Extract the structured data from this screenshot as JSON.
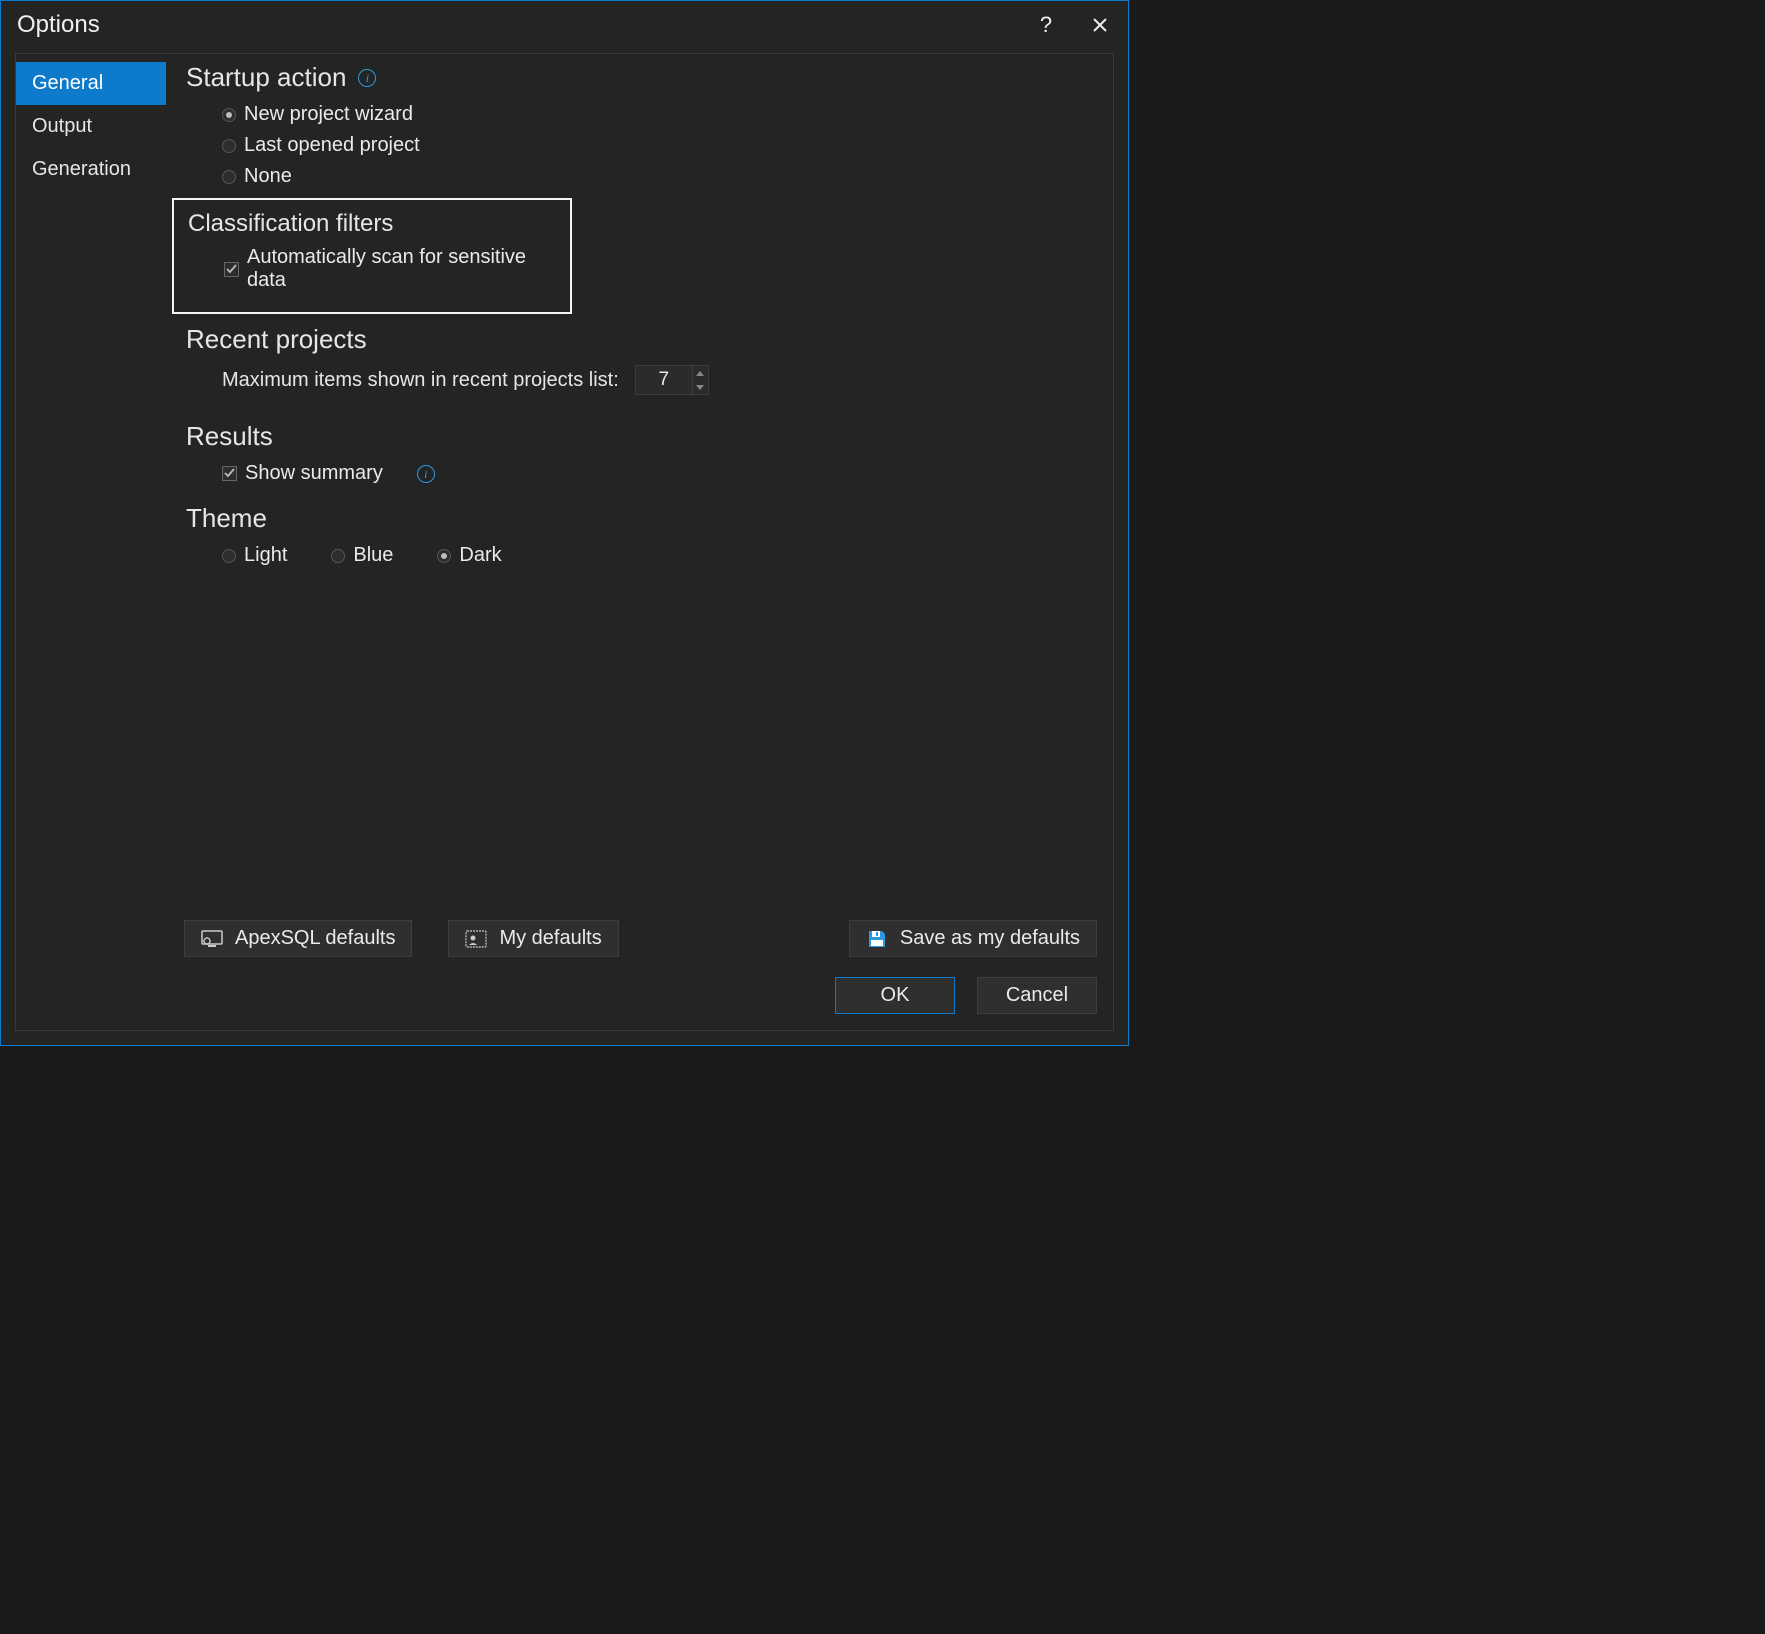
{
  "window": {
    "title": "Options"
  },
  "sidebar": {
    "items": [
      {
        "label": "General",
        "active": true
      },
      {
        "label": "Output",
        "active": false
      },
      {
        "label": "Generation",
        "active": false
      }
    ]
  },
  "sections": {
    "startup": {
      "title": "Startup action",
      "options": {
        "new_project": "New project wizard",
        "last_opened": "Last opened project",
        "none": "None"
      },
      "selected": "new_project"
    },
    "classification": {
      "title": "Classification filters",
      "auto_scan": {
        "label": "Automatically scan for sensitive data",
        "checked": true
      }
    },
    "recent": {
      "title": "Recent projects",
      "label": "Maximum items shown in recent projects list:",
      "value": "7"
    },
    "results": {
      "title": "Results",
      "show_summary": {
        "label": "Show summary",
        "checked": true
      }
    },
    "theme": {
      "title": "Theme",
      "options": {
        "light": "Light",
        "blue": "Blue",
        "dark": "Dark"
      },
      "selected": "dark"
    }
  },
  "footer": {
    "apex": "ApexSQL defaults",
    "my": "My defaults",
    "save": "Save as my defaults",
    "ok": "OK",
    "cancel": "Cancel"
  }
}
